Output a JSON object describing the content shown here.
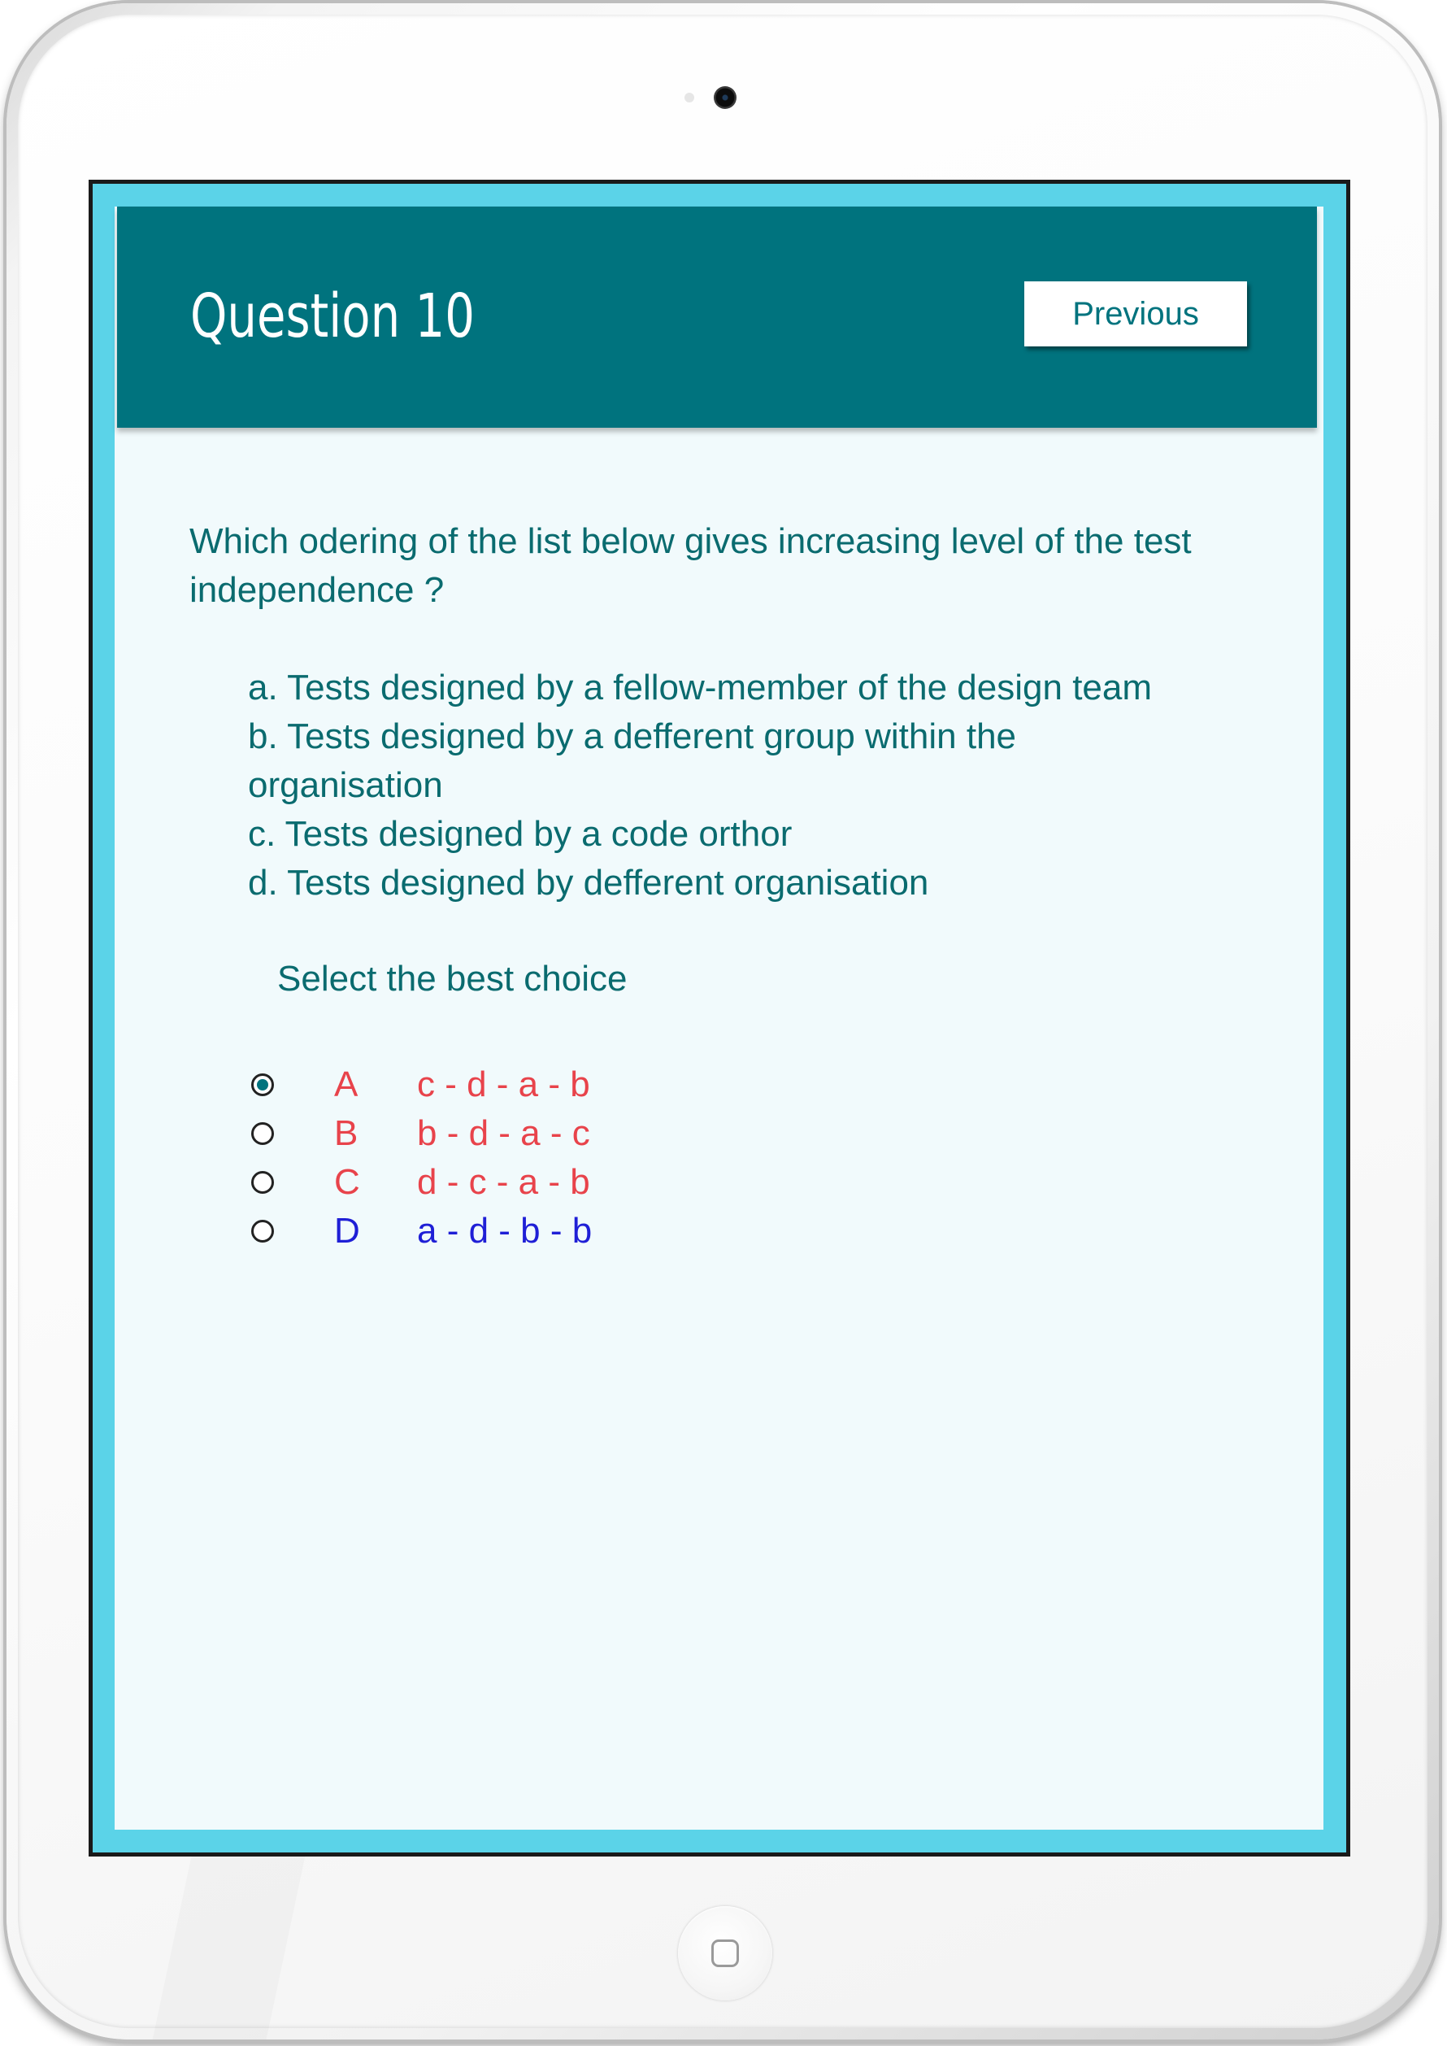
{
  "header": {
    "title": "Question 10",
    "previous_label": "Previous"
  },
  "question": {
    "text": "Which odering of the list below gives increasing level of the test independence ?",
    "items": [
      "a. Tests designed by a fellow-member of the design team",
      "b. Tests designed by a defferent group within the organisation",
      "c. Tests designed by a code orthor",
      "d. Tests designed by defferent organisation"
    ],
    "instruction": "Select the best choice"
  },
  "choices": [
    {
      "letter": "A",
      "sequence": "c - d - a - b",
      "selected": true,
      "color": "#e8434b"
    },
    {
      "letter": "B",
      "sequence": "b - d - a - c",
      "selected": false,
      "color": "#e8434b"
    },
    {
      "letter": "C",
      "sequence": "d - c - a - b",
      "selected": false,
      "color": "#e8434b"
    },
    {
      "letter": "D",
      "sequence": "a - d - b - b",
      "selected": false,
      "color": "#1f1fd6"
    }
  ],
  "colors": {
    "header": "#00737e",
    "screen_frame": "#5bd3e8",
    "text": "#0a6b6f"
  }
}
